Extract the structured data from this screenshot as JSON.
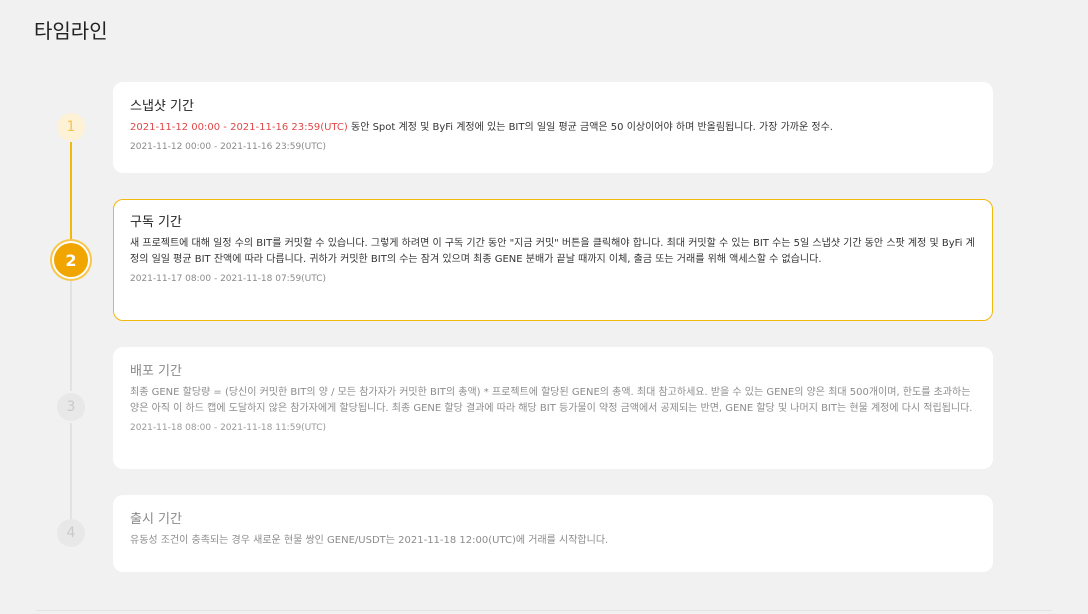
{
  "page": {
    "title": "타임라인"
  },
  "steps": [
    {
      "number": "1",
      "title": "스냅샷 기간",
      "highlight": "2021-11-12 00:00 - 2021-11-16 23:59(UTC)",
      "body": " 동안 Spot 계정 및 ByFi 계정에 있는 BIT의 일일 평균 금액은 50 이상이어야 하며 반올림됩니다. 가장 가까운 정수.",
      "date": "2021-11-12 00:00 - 2021-11-16 23:59(UTC)"
    },
    {
      "number": "2",
      "title": "구독 기간",
      "body": "새 프로젝트에 대해 일정 수의 BIT를 커밋할 수 있습니다. 그렇게 하려면 이 구독 기간 동안 \"지금 커밋\" 버튼을 클릭해야 합니다. 최대 커밋할 수 있는 BIT 수는 5일 스냅샷 기간 동안 스팟 계정 및 ByFi 계정의 일일 평균 BIT 잔액에 따라 다릅니다. 귀하가 커밋한 BIT의 수는 잠겨 있으며 최종 GENE 분배가 끝날 때까지 이체, 출금 또는 거래를 위해 액세스할 수 없습니다.",
      "date": "2021-11-17 08:00 - 2021-11-18 07:59(UTC)"
    },
    {
      "number": "3",
      "title": "배포 기간",
      "body": "최종 GENE 할당량 = (당신이 커밋한 BIT의 양 / 모든 참가자가 커밋한 BIT의 총액) * 프로젝트에 할당된 GENE의 총액. 최대 참고하세요. 받을 수 있는 GENE의 양은 최대 500개이며, 한도를 초과하는 양은 아직 이 하드 캡에 도달하지 않은 참가자에게 할당됩니다. 최종 GENE 할당 결과에 따라 해당 BIT 등가물이 약정 금액에서 공제되는 반면, GENE 할당 및 나머지 BIT는 현물 계정에 다시 적립됩니다.",
      "date": "2021-11-18 08:00 - 2021-11-18 11:59(UTC)"
    },
    {
      "number": "4",
      "title": "출시 기간",
      "body": "유동성 조건이 충족되는 경우 새로운 현물 쌍인 GENE/USDT는 2021-11-18 12:00(UTC)에 거래를 시작합니다."
    }
  ],
  "colors": {
    "accent": "#f0b90b",
    "active_step": "#f0a500",
    "highlight_text": "#e04848"
  }
}
